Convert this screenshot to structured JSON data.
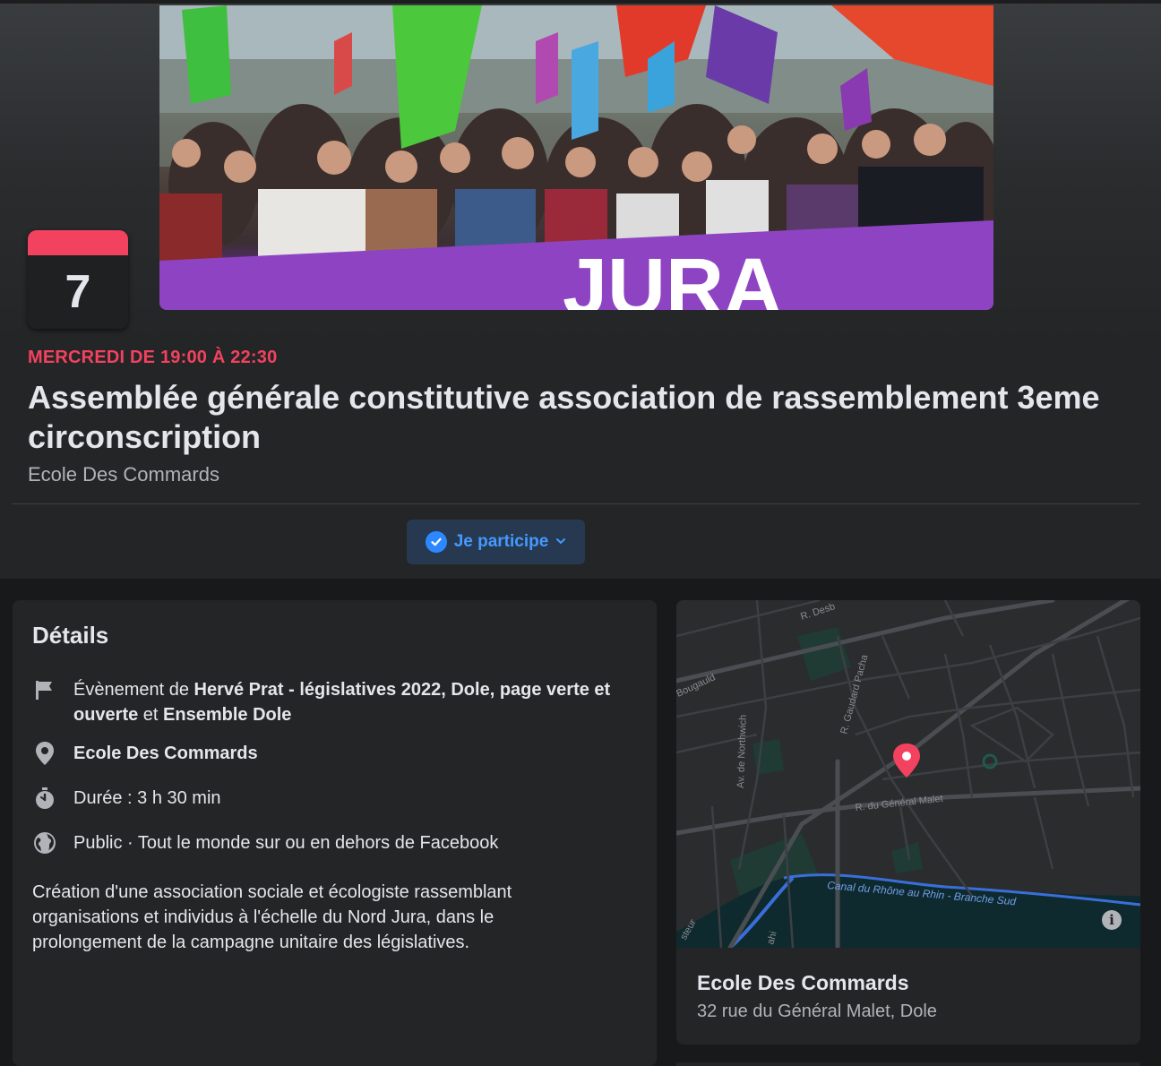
{
  "event": {
    "date_day": "7",
    "when": "MERCREDI DE 19:00 À 22:30",
    "title": "Assemblée générale constitutive association de rassemblement 3eme circonscription",
    "location": "Ecole Des Commards",
    "rsvp_label": "Je participe",
    "cover_banner_text": "JURA"
  },
  "details": {
    "heading": "Détails",
    "organizer_prefix": "Évènement de ",
    "organizer_1": "Hervé Prat - législatives 2022, Dole, page verte et ouverte",
    "organizer_joiner": " et ",
    "organizer_2": "Ensemble Dole",
    "place": "Ecole Des Commards",
    "duration": "Durée : 3 h 30 min",
    "privacy": "Public · Tout le monde sur ou en dehors de Facebook",
    "description": "Création d'une association sociale et écologiste rassemblant organisations et individus à l'échelle du Nord Jura, dans le prolongement de la campagne unitaire des législatives."
  },
  "map": {
    "place_name": "Ecole Des Commards",
    "address": "32 rue du Général Malet, Dole",
    "street_labels": [
      "R. Desb",
      "Bougauld",
      "R. Gaudard Pacha",
      "Av. de Northwich",
      "R. du Général Malet",
      "Canal du Rhône au Rhin - Branche Sud",
      "steur",
      "ahi"
    ],
    "info_glyph": "i"
  },
  "colors": {
    "accent_red": "#f3425f",
    "accent_blue": "#4599ff",
    "card_bg": "#242526",
    "page_bg": "#18191a"
  }
}
